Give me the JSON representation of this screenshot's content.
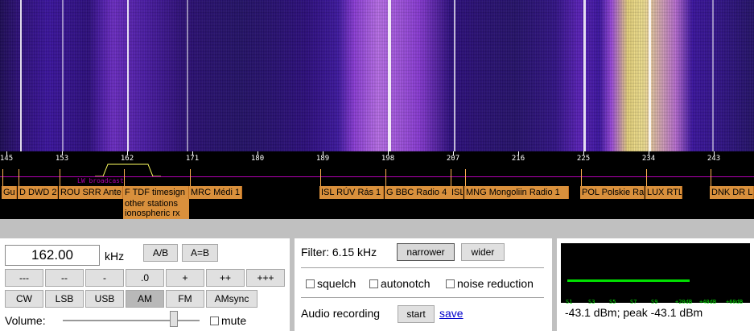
{
  "scale": {
    "ticks": [
      "145",
      "153",
      "162",
      "171",
      "180",
      "189",
      "198",
      "207",
      "216",
      "225",
      "234",
      "243"
    ],
    "band_label": "LW broadcast"
  },
  "stations": [
    {
      "label": "Gu"
    },
    {
      "label": "D DWD 2"
    },
    {
      "label": "ROU SRR Ante"
    },
    {
      "label": "F TDF timesign"
    },
    {
      "label": "MRC Médi 1"
    },
    {
      "label": "ISL RÚV Rás 1"
    },
    {
      "label": "G BBC Radio 4"
    },
    {
      "label": "ISL"
    },
    {
      "label": "MNG Mongoliin Radio 1"
    },
    {
      "label": "POL Polskie Ra"
    },
    {
      "label": "LUX RTL"
    },
    {
      "label": "DNK DR La"
    }
  ],
  "station_extra": [
    "other stations",
    "ionospheric rx"
  ],
  "frequency": {
    "value": "162.00",
    "unit": "kHz"
  },
  "buttons": {
    "ab": "A/B",
    "a_eq_b": "A=B",
    "step": [
      "---",
      "--",
      "-",
      ".0",
      "+",
      "++",
      "+++"
    ],
    "modes": [
      "CW",
      "LSB",
      "USB",
      "AM",
      "FM",
      "AMsync"
    ],
    "active_mode": "AM"
  },
  "volume": {
    "label": "Volume:",
    "level": 0.8,
    "mute_label": "mute",
    "mute_checked": false
  },
  "filter": {
    "label": "Filter: 6.15 kHz",
    "narrower": "narrower",
    "wider": "wider",
    "checkboxes": [
      "squelch",
      "autonotch",
      "noise reduction"
    ]
  },
  "recording": {
    "label": "Audio recording",
    "start": "start",
    "save": "save"
  },
  "smeter": {
    "ticks": [
      "S1",
      "S3",
      "S5",
      "S7",
      "S9",
      "+20dB",
      "+40dB",
      "+60dB"
    ],
    "level": 0.66,
    "reading": "-43.1 dBm; peak  -43.1 dBm"
  },
  "colors": {
    "station_bg": "#d9903c",
    "band_line": "#b000b0",
    "meter": "#00e000"
  }
}
